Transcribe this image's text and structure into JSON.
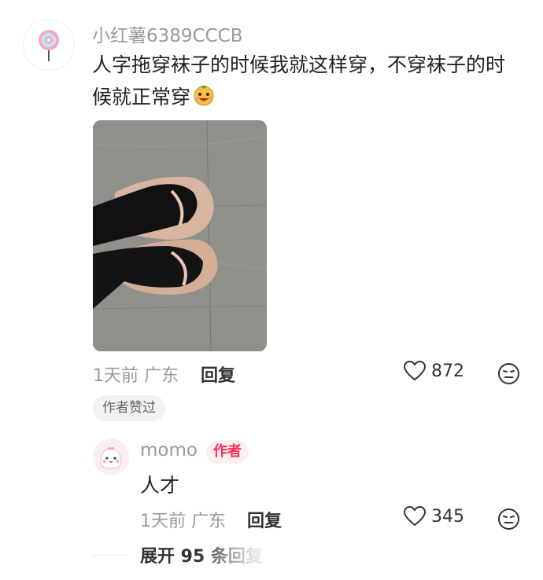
{
  "comment": {
    "username": "小红薯6389CCCB",
    "text": "人字拖穿袜子的时候我就这样穿，不穿袜子的时候就正常穿",
    "emoji": "emoji-laughing-icon",
    "time": "1天前",
    "location": "广东",
    "reply_label": "回复",
    "likes": "872",
    "liked_by_author": "作者赞过"
  },
  "reply": {
    "username": "momo",
    "author_tag": "作者",
    "text": "人才",
    "time": "1天前",
    "location": "广东",
    "reply_label": "回复",
    "likes": "345"
  },
  "expand_replies": "展开 95 条回复"
}
